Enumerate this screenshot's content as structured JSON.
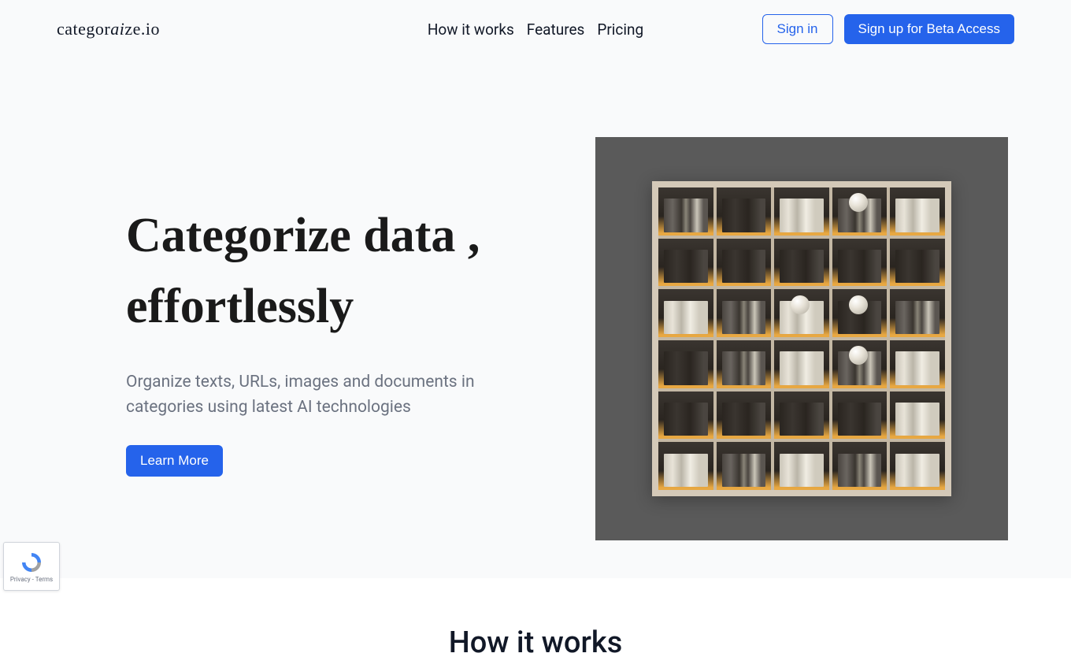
{
  "header": {
    "logo_text": "categoraize.io",
    "nav": [
      {
        "label": "How it works"
      },
      {
        "label": "Features"
      },
      {
        "label": "Pricing"
      }
    ],
    "signin_label": "Sign in",
    "signup_label": "Sign up for Beta Access"
  },
  "hero": {
    "title": "Categorize data , effortlessly",
    "subtitle": "Organize texts, URLs, images and documents in categories using latest AI technologies",
    "learn_more_label": "Learn More",
    "image_alt": "bookshelf"
  },
  "section": {
    "title": "How it works"
  },
  "recaptcha": {
    "privacy": "Privacy",
    "terms": "Terms"
  }
}
